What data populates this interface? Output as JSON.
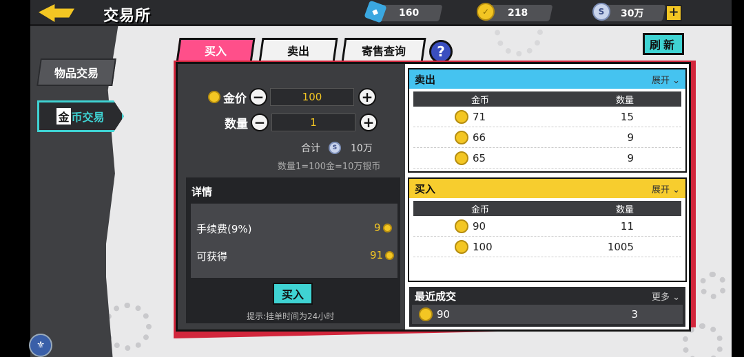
{
  "header": {
    "title": "交易所",
    "gems": "160",
    "gold": "218",
    "silver": "30万",
    "add_label": "+"
  },
  "sidebar": {
    "items": [
      {
        "label": "物品交易"
      },
      {
        "first_char": "金",
        "rest": "币交易"
      }
    ]
  },
  "tabs": [
    {
      "label": "买入"
    },
    {
      "label": "卖出"
    },
    {
      "label": "寄售查询"
    }
  ],
  "help_label": "?",
  "refresh_label": "刷新",
  "order_form": {
    "price_label": "金价",
    "price_value": "100",
    "qty_label": "数量",
    "qty_value": "1",
    "minus": "−",
    "plus": "+",
    "total_label": "合计",
    "total_value": "10万",
    "rate_hint": "数量1=100金=10万银币"
  },
  "details": {
    "title": "详情",
    "fee_label": "手续费(9%)",
    "fee_value": "9",
    "gain_label": "可获得",
    "gain_value": "91",
    "buy_button": "买入",
    "tip": "提示:挂单时间为24小时"
  },
  "sell_book": {
    "title": "卖出",
    "expand": "展开",
    "col_price": "金币",
    "col_qty": "数量",
    "rows": [
      {
        "price": "71",
        "qty": "15"
      },
      {
        "price": "66",
        "qty": "9"
      },
      {
        "price": "65",
        "qty": "9"
      }
    ]
  },
  "buy_book": {
    "title": "买入",
    "expand": "展开",
    "col_price": "金币",
    "col_qty": "数量",
    "rows": [
      {
        "price": "90",
        "qty": "11"
      },
      {
        "price": "100",
        "qty": "1005"
      }
    ]
  },
  "recent": {
    "title": "最近成交",
    "more": "更多",
    "rows": [
      {
        "price": "90",
        "qty": "3"
      }
    ]
  },
  "colors": {
    "accent_cyan": "#3fd3d3",
    "accent_pink": "#ff4f8a",
    "sell_header": "#45c3f0",
    "buy_header": "#f7cd2e",
    "frame_red": "#d2263c",
    "gold": "#f3c623"
  }
}
